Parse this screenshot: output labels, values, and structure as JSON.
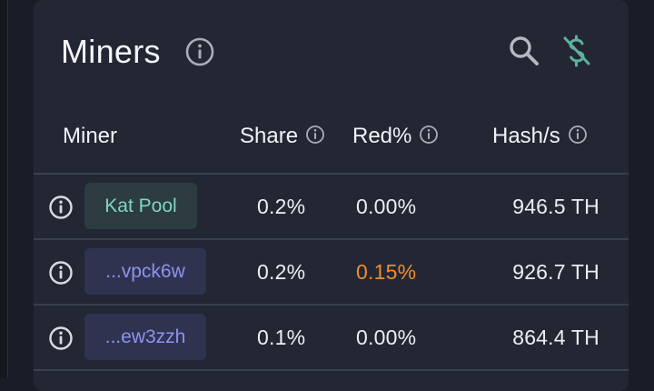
{
  "title": "Miners",
  "toolbar": {
    "search_icon": "search-icon",
    "currency_icon": "dollar-off-icon"
  },
  "columns": [
    {
      "label": "Miner"
    },
    {
      "label": "Share"
    },
    {
      "label": "Red%"
    },
    {
      "label": "Hash/s"
    }
  ],
  "rows": [
    {
      "miner": "Kat Pool",
      "type": "pool",
      "share": "0.2%",
      "red": "0.00%",
      "hash": "946.5 TH"
    },
    {
      "miner": "...vpck6w",
      "type": "address",
      "share": "0.2%",
      "red": "0.15%",
      "hash": "926.7 TH"
    },
    {
      "miner": "...ew3zzh",
      "type": "address",
      "share": "0.1%",
      "red": "0.00%",
      "hash": "864.4 TH"
    }
  ],
  "colors": {
    "background": "#1a1d27",
    "card": "#232734",
    "pool_chip_text": "#7fd6c0",
    "address_chip_text": "#8d93ee",
    "warning": "#f08c2c"
  }
}
